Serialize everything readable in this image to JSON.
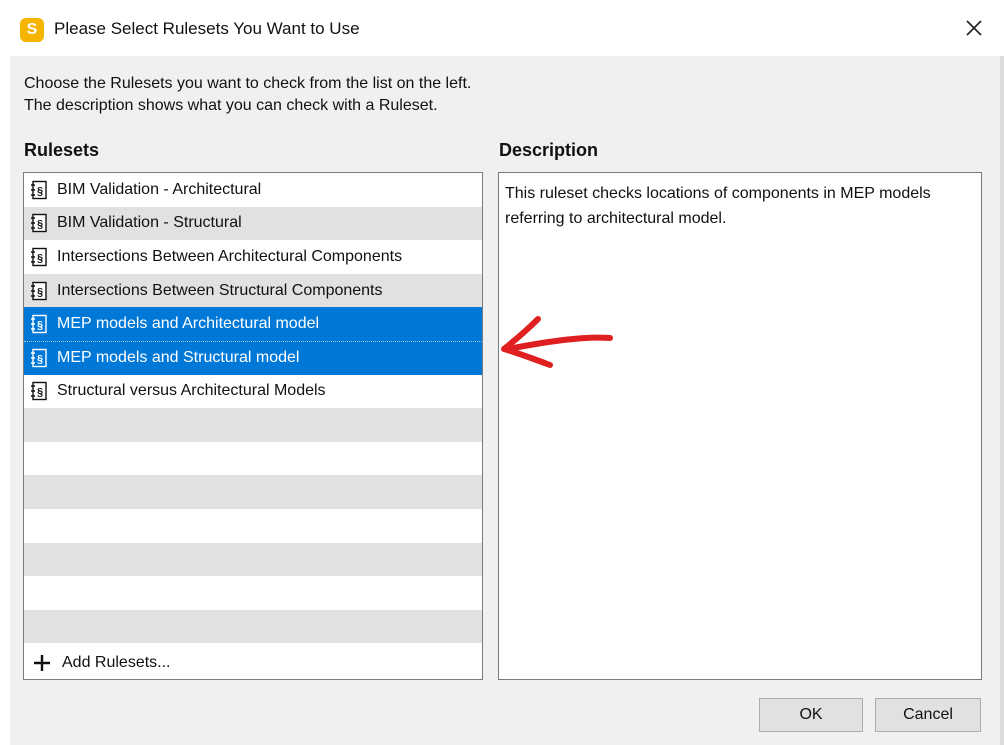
{
  "window": {
    "title": "Please Select Rulesets You Want to Use",
    "app_icon_letter": "S",
    "close_glyph": "✕"
  },
  "instructions": {
    "line1": "Choose the Rulesets you want to check from the list on the left.",
    "line2": "The description shows what you can check with a Ruleset."
  },
  "rulesets": {
    "heading": "Rulesets",
    "icon": "ruleset-document-icon",
    "items": [
      {
        "label": "BIM Validation - Architectural",
        "selected": false
      },
      {
        "label": "BIM Validation - Structural",
        "selected": false
      },
      {
        "label": "Intersections Between Architectural Components",
        "selected": false
      },
      {
        "label": "Intersections Between Structural Components",
        "selected": false
      },
      {
        "label": "MEP models and Architectural model",
        "selected": true
      },
      {
        "label": "MEP models and Structural model",
        "selected": true
      },
      {
        "label": "Structural versus Architectural Models",
        "selected": false
      }
    ],
    "add_label": "Add Rulesets..."
  },
  "description": {
    "heading": "Description",
    "text": "This ruleset checks locations of components in MEP models referring to architectural model."
  },
  "buttons": {
    "ok": "OK",
    "cancel": "Cancel"
  },
  "colors": {
    "selection": "#0078d7",
    "alt_row": "#e1e1e1",
    "app_icon": "#f5b400",
    "annotation_arrow": "#e02020"
  }
}
